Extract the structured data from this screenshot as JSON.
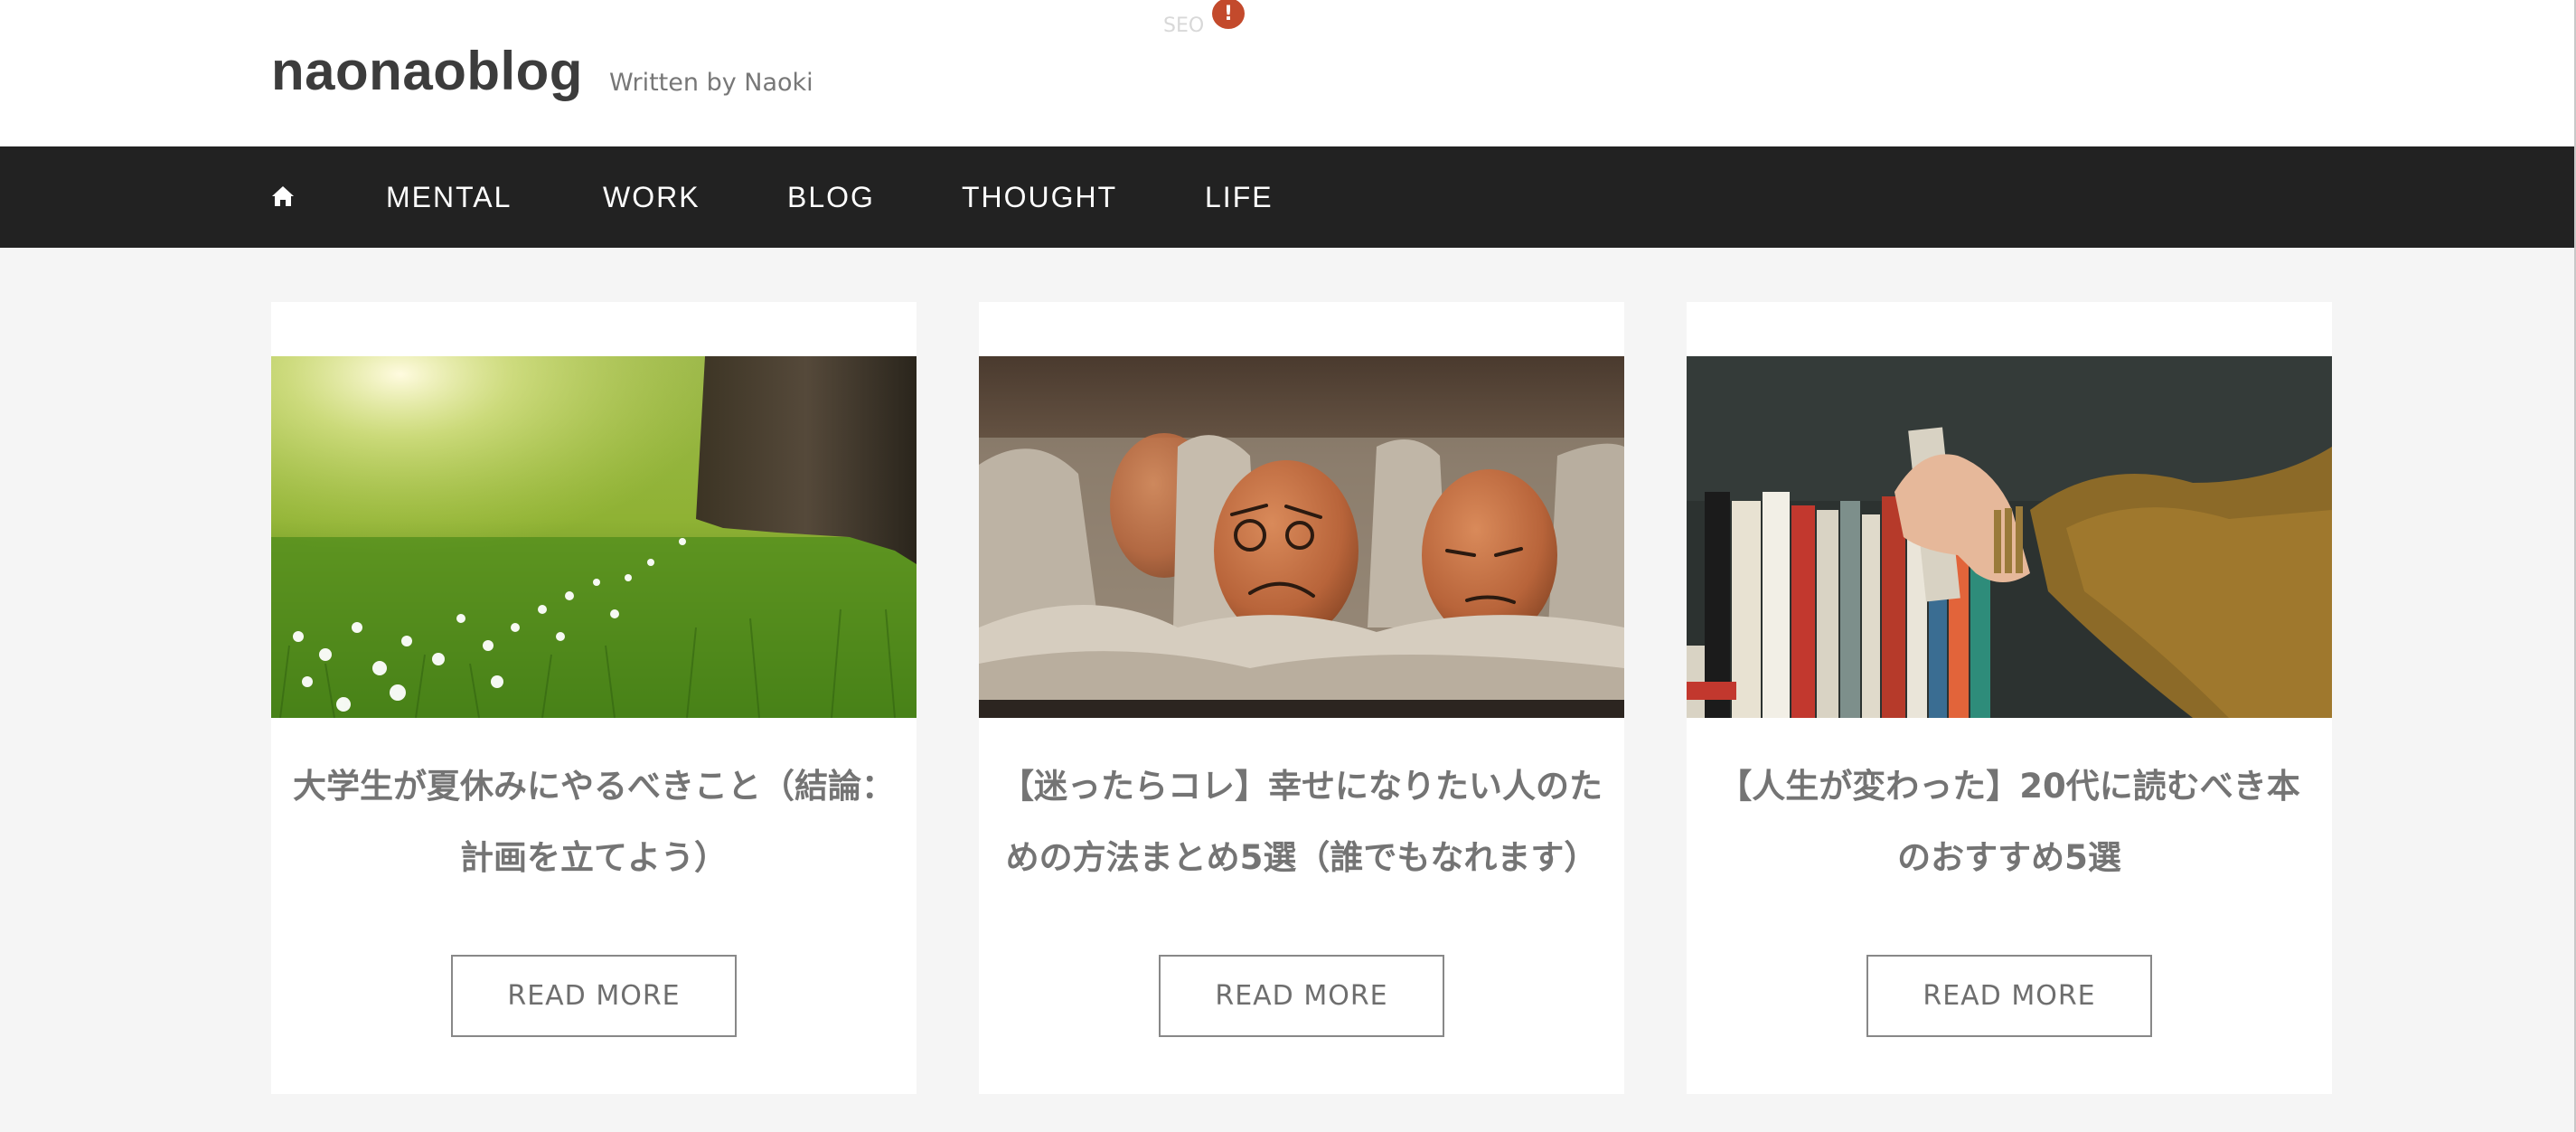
{
  "header": {
    "site_title": "naonaoblog",
    "tagline": "Written by Naoki",
    "seo_label": "SEO",
    "seo_alert": "!"
  },
  "nav": {
    "home_icon": "home-icon",
    "items": [
      {
        "label": "MENTAL"
      },
      {
        "label": "WORK"
      },
      {
        "label": "BLOG"
      },
      {
        "label": "THOUGHT"
      },
      {
        "label": "LIFE"
      }
    ]
  },
  "posts": [
    {
      "title_line1": "大学生が夏休みにやるべきこと（結論：",
      "title_line2": "計画を立てよう）",
      "button": "READ MORE",
      "image": "meadow-with-tree-photo"
    },
    {
      "title_line1": "【迷ったらコレ】幸せになりたい人のた",
      "title_line2": "めの方法まとめ5選（誰でもなれます）",
      "button": "READ MORE",
      "image": "sad-eggs-in-carton-photo"
    },
    {
      "title_line1": "【人生が変わった】20代に読むべき本",
      "title_line2": "のおすすめ5選",
      "button": "READ MORE",
      "image": "hand-pulling-book-from-shelf-photo"
    }
  ],
  "colors": {
    "navbar": "#222222",
    "page_bg": "#f5f5f5",
    "alert": "#c34a2c",
    "card_title": "#747474"
  }
}
